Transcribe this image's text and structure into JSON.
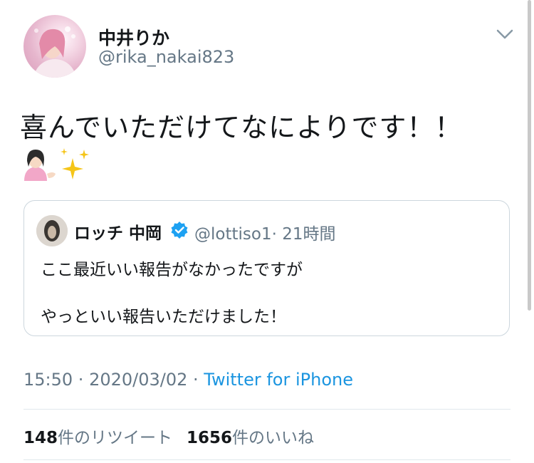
{
  "author": {
    "display_name": "中井りか",
    "handle": "@rika_nakai823"
  },
  "tweet": {
    "text": "喜んでいただけてなによりです！！",
    "emoji": [
      "woman-tipping-hand",
      "sparkles"
    ]
  },
  "quoted_tweet": {
    "author_name": "ロッチ 中岡",
    "verified": true,
    "handle": "@lottiso1",
    "time": "· 21時間",
    "lines": [
      "ここ最近いい報告がなかったですが",
      "",
      "やっといい報告いただけました！"
    ]
  },
  "meta": {
    "time": "15:50",
    "separator_1": " · ",
    "date": "2020/03/02",
    "separator_2": " · ",
    "source": "Twitter for iPhone"
  },
  "stats": {
    "retweets_count": "148",
    "retweets_label": "件のリツイート",
    "likes_count": "1656",
    "likes_label": "件のいいね"
  },
  "colors": {
    "link": "#1b95e0",
    "muted": "#657786",
    "border": "#ccd6dd",
    "verified": "#1da1f2"
  }
}
